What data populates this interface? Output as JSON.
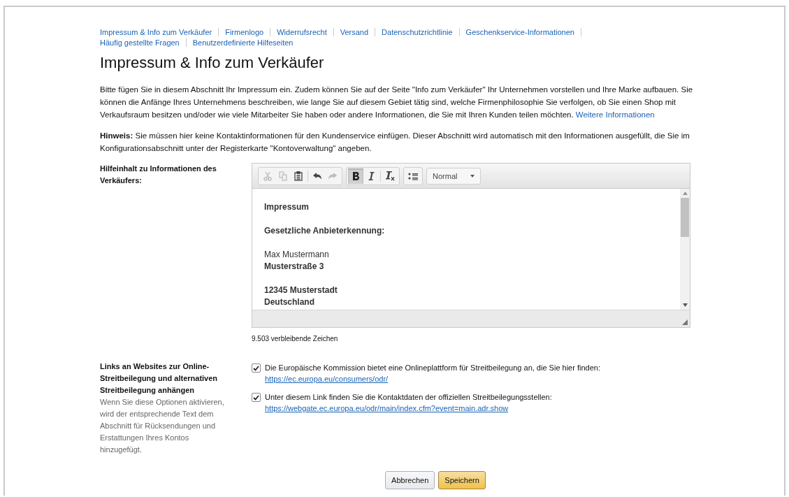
{
  "nav_links": [
    {
      "label": "Impressum & Info zum Verkäufer"
    },
    {
      "label": "Firmenlogo"
    },
    {
      "label": "Widerrufsrecht"
    },
    {
      "label": "Versand"
    },
    {
      "label": "Datenschutzrichtlinie"
    },
    {
      "label": "Geschenkservice-Informationen"
    },
    {
      "label": "Häufig gestellte Fragen"
    },
    {
      "label": "Benutzerdefinierte Hilfeseiten"
    }
  ],
  "title": "Impressum & Info zum Verkäufer",
  "intro": {
    "text": "Bitte fügen Sie in diesem Abschnitt Ihr Impressum ein. Zudem können Sie auf der Seite \"Info zum Verkäufer\" Ihr Unternehmen vorstellen und Ihre Marke aufbauen. Sie können die Anfänge Ihres Unternehmens beschreiben, wie lange Sie auf diesem Gebiet tätig sind, welche Firmenphilosophie Sie verfolgen, ob Sie einen Shop mit Verkaufsraum besitzen und/oder wie viele Mitarbeiter Sie haben oder andere Informationen, die Sie mit Ihren Kunden teilen möchten.",
    "link": "Weitere Informationen"
  },
  "hint": "**Hinweis:** Sie müssen hier keine Kontaktinformationen für den Kundenservice einfügen. Dieser Abschnitt wird automatisch mit den Informationen ausgefüllt, die Sie im Konfigurationsabschnitt unter der Registerkarte \"Kontoverwaltung\" angeben.",
  "editor_label": "Hilfeinhalt zu Informationen des Verkäufers:",
  "toolbar": [
    {
      "kind": "cut",
      "disabled": true,
      "active": false
    },
    {
      "kind": "copy",
      "disabled": true,
      "active": false
    },
    {
      "kind": "paste",
      "disabled": false,
      "active": false
    },
    {
      "kind": "separator"
    },
    {
      "kind": "undo",
      "disabled": false,
      "active": false
    },
    {
      "kind": "redo",
      "disabled": true,
      "active": false
    },
    {
      "kind": "group"
    },
    {
      "kind": "bold",
      "disabled": false,
      "active": true
    },
    {
      "kind": "italic",
      "disabled": false,
      "active": false
    },
    {
      "kind": "separator"
    },
    {
      "kind": "clear-format",
      "disabled": false,
      "active": false
    },
    {
      "kind": "group"
    },
    {
      "kind": "list",
      "disabled": false,
      "active": false
    },
    {
      "kind": "group"
    }
  ],
  "format_select": "Normal",
  "editor_lines": [
    {
      "text": "Impressum",
      "bold": true,
      "space_before": false
    },
    {
      "text": "Gesetzliche Anbieterkennung:",
      "bold": true,
      "space_before": true
    },
    {
      "text": "Max Mustermann",
      "bold": false,
      "space_before": true
    },
    {
      "text": "Musterstraße 3",
      "bold": true,
      "space_before": false
    },
    {
      "text": "12345 Musterstadt",
      "bold": true,
      "space_before": true
    },
    {
      "text": "Deutschland",
      "bold": true,
      "space_before": false
    }
  ],
  "remaining_chars": "9.503 verbleibende Zeichen",
  "links_section": {
    "label": "Links an Websites zur Online-Streitbeilegung und alternativen Streitbeilegung anhängen",
    "help": "Wenn Sie diese Optionen aktivieren, wird der entsprechende Text dem Abschnitt für Rücksendungen und Erstattungen Ihres Kontos hinzugefügt.",
    "options": [
      {
        "text": "Die Europäische Kommission bietet eine Onlineplattform für Streitbeilegung an, die Sie hier finden:",
        "url": "https://ec.europa.eu/consumers/odr/",
        "checked": true
      },
      {
        "text": "Unter diesem Link finden Sie die Kontaktdaten der offiziellen Streitbeilegungsstellen:",
        "url": "https://webgate.ec.europa.eu/odr/main/index.cfm?event=main.adr.show",
        "checked": true
      }
    ]
  },
  "buttons": [
    {
      "label": "Abbrechen",
      "kind": "secondary"
    },
    {
      "label": "Speichern",
      "kind": "primary"
    }
  ]
}
